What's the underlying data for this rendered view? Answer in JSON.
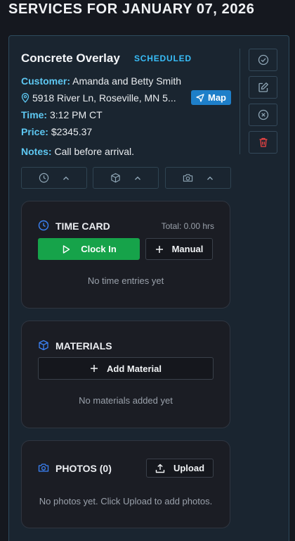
{
  "page": {
    "heading": "SERVICES FOR JANUARY 07, 2026"
  },
  "job": {
    "title": "Concrete Overlay",
    "status": "SCHEDULED",
    "customer_label": "Customer:",
    "customer": "Amanda and Betty Smith",
    "address": "5918 River Ln, Roseville, MN 5...",
    "map_label": "Map",
    "time_label": "Time:",
    "time": "3:12 PM CT",
    "price_label": "Price:",
    "price": "$2345.37",
    "notes_label": "Notes:",
    "notes": "Call before arrival."
  },
  "actions": [
    {
      "icon": "check-circle-icon",
      "color": "#8fa6b6"
    },
    {
      "icon": "edit-icon",
      "color": "#8fa6b6"
    },
    {
      "icon": "cancel-circle-icon",
      "color": "#8fa6b6"
    },
    {
      "icon": "trash-icon",
      "color": "#ef4444"
    }
  ],
  "toggles": [
    {
      "icon": "clock-icon"
    },
    {
      "icon": "box-icon"
    },
    {
      "icon": "camera-icon"
    }
  ],
  "time_card": {
    "title": "TIME CARD",
    "total": "Total: 0.00 hrs",
    "clock_in_label": "Clock In",
    "manual_label": "Manual",
    "empty": "No time entries yet"
  },
  "materials": {
    "title": "MATERIALS",
    "add_label": "Add Material",
    "empty": "No materials added yet"
  },
  "photos": {
    "title": "PHOTOS (0)",
    "upload_label": "Upload",
    "empty": "No photos yet. Click Upload to add photos."
  },
  "colors": {
    "accent": "#38bdf8",
    "label_blue": "#5ec8f2",
    "success": "#16a34a",
    "danger": "#ef4444",
    "panel_icon": "#3b82f6"
  }
}
